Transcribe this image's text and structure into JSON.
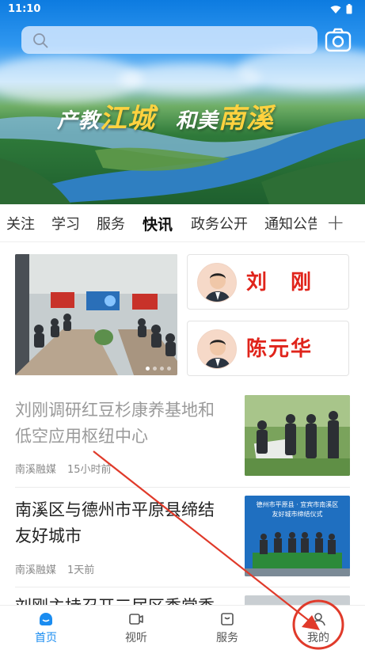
{
  "status_bar": {
    "time": "11:10"
  },
  "search": {
    "placeholder": ""
  },
  "banner": {
    "slogan_part1": "产教",
    "slogan_part2": "江城",
    "slogan_part3": "和美",
    "slogan_part4": "南溪"
  },
  "tabs": [
    {
      "label": "关注"
    },
    {
      "label": "学习"
    },
    {
      "label": "服务"
    },
    {
      "label": "快讯",
      "active": true
    },
    {
      "label": "政务公开"
    },
    {
      "label": "通知公告"
    }
  ],
  "featured": {
    "people": [
      {
        "name": "刘　刚"
      },
      {
        "name": "陈元华"
      }
    ]
  },
  "news": [
    {
      "title": "刘刚调研红豆杉康养基地和低空应用枢纽中心",
      "source": "南溪融媒",
      "time": "15小时前",
      "read": true
    },
    {
      "title": "南溪区与德州市平原县缔结友好城市",
      "source": "南溪融媒",
      "time": "1天前",
      "read": false,
      "thumb_text_line1": "德州市平原县 · 宜宾市南溪区",
      "thumb_text_line2": "友好城市缔结仪式"
    },
    {
      "title": "刘刚主持召开三届区委常委",
      "read": false
    }
  ],
  "bottom_nav": [
    {
      "label": "首页",
      "icon": "home-icon",
      "active": true
    },
    {
      "label": "视听",
      "icon": "video-icon"
    },
    {
      "label": "服务",
      "icon": "service-icon"
    },
    {
      "label": "我的",
      "icon": "user-icon"
    }
  ],
  "colors": {
    "accent": "#1a8cf0",
    "leader_name": "#e0241b",
    "annotation": "#e03a2a"
  }
}
